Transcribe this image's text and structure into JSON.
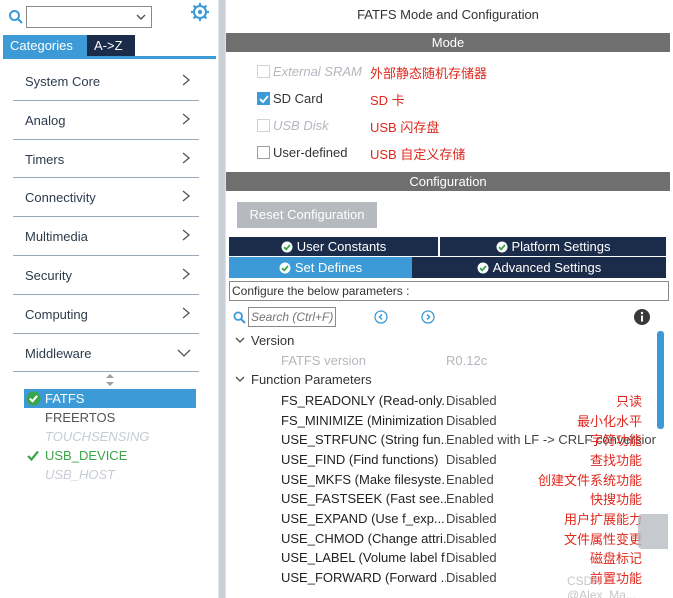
{
  "left": {
    "tabs": [
      {
        "label": "Categories"
      },
      {
        "label": "A->Z"
      }
    ],
    "categories": [
      {
        "label": "System Core",
        "arrow": "chevron-right-icon"
      },
      {
        "label": "Analog",
        "arrow": "chevron-right-icon"
      },
      {
        "label": "Timers",
        "arrow": "chevron-right-icon"
      },
      {
        "label": "Connectivity",
        "arrow": "chevron-right-icon"
      },
      {
        "label": "Multimedia",
        "arrow": "chevron-right-icon"
      },
      {
        "label": "Security",
        "arrow": "chevron-right-icon"
      },
      {
        "label": "Computing",
        "arrow": "chevron-right-icon"
      },
      {
        "label": "Middleware",
        "arrow": "chevron-down-icon"
      }
    ],
    "middleware": [
      {
        "label": "FATFS",
        "state": "selected",
        "icon": "check-circle-icon"
      },
      {
        "label": "FREERTOS",
        "state": "normal"
      },
      {
        "label": "TOUCHSENSING",
        "state": "disabled"
      },
      {
        "label": "USB_DEVICE",
        "state": "green",
        "icon": "check-icon"
      },
      {
        "label": "USB_HOST",
        "state": "disabled"
      }
    ]
  },
  "right": {
    "title": "FATFS Mode and Configuration",
    "mode_band": "Mode",
    "mode_options": [
      {
        "label": "External SRAM",
        "checked": false,
        "disabled": true,
        "note": "外部静态随机存储器"
      },
      {
        "label": "SD Card",
        "checked": true,
        "disabled": false,
        "note": "SD 卡"
      },
      {
        "label": "USB Disk",
        "checked": false,
        "disabled": true,
        "note": "USB 闪存盘"
      },
      {
        "label": "User-defined",
        "checked": false,
        "disabled": false,
        "note": "USB 自定义存储"
      }
    ],
    "config_band": "Configuration",
    "reset_label": "Reset Configuration",
    "tabs_row1": [
      {
        "label": "User Constants"
      },
      {
        "label": "Platform Settings"
      }
    ],
    "tabs_row2": [
      {
        "label": "Set Defines"
      },
      {
        "label": "Advanced Settings"
      }
    ],
    "hint": "Configure the below parameters :",
    "search_placeholder": "Search (Ctrl+F)",
    "groups": {
      "version": "Version",
      "function": "Function Parameters"
    },
    "version_row": {
      "name": "FATFS version",
      "value": "R0.12c"
    },
    "params": [
      {
        "name": "FS_READONLY (Read-only...",
        "value": "Disabled",
        "note": "只读"
      },
      {
        "name": "FS_MINIMIZE (Minimization l...",
        "value": "Disabled",
        "note": "最小化水平"
      },
      {
        "name": "USE_STRFUNC (String fun...",
        "value": "Enabled with LF -> CRLF conversion",
        "note": "字符功能"
      },
      {
        "name": "USE_FIND (Find functions)",
        "value": "Disabled",
        "note": "查找功能"
      },
      {
        "name": "USE_MKFS (Make filesyste...",
        "value": "Enabled",
        "note": "创建文件系统功能"
      },
      {
        "name": "USE_FASTSEEK (Fast see...",
        "value": "Enabled",
        "note": "快搜功能"
      },
      {
        "name": "USE_EXPAND (Use f_exp...",
        "value": "Disabled",
        "note": "用户扩展能力"
      },
      {
        "name": "USE_CHMOD (Change attri...",
        "value": "Disabled",
        "note": "文件属性变更"
      },
      {
        "name": "USE_LABEL (Volume label f...",
        "value": "Disabled",
        "note": "磁盘标记"
      },
      {
        "name": "USE_FORWARD (Forward ...",
        "value": "Disabled",
        "note": "前置功能"
      }
    ],
    "watermark": "CSDN @Alex_Ma..."
  },
  "colors": {
    "accent": "#3c9bd6",
    "dark_tab": "#1b2b4a",
    "band": "#6f6f6f",
    "annotation": "#e0281e",
    "enabled_green": "#3aa54a"
  }
}
